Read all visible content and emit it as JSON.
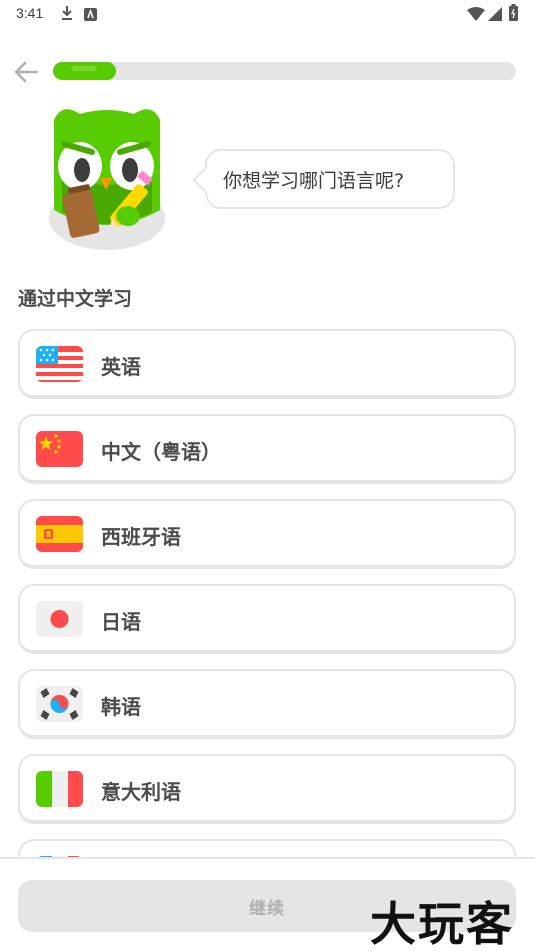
{
  "status_bar": {
    "time": "3:41"
  },
  "header": {
    "progress": 0.135
  },
  "mascot": {
    "speech": "你想学习哪门语言呢?"
  },
  "section": {
    "title": "通过中文学习"
  },
  "languages": [
    {
      "label": "英语",
      "flag": "us-flag-icon"
    },
    {
      "label": "中文（粤语）",
      "flag": "china-flag-icon"
    },
    {
      "label": "西班牙语",
      "flag": "spain-flag-icon"
    },
    {
      "label": "日语",
      "flag": "japan-flag-icon"
    },
    {
      "label": "韩语",
      "flag": "korea-flag-icon"
    },
    {
      "label": "意大利语",
      "flag": "italy-flag-icon"
    }
  ],
  "footer": {
    "continue_label": "继续"
  },
  "watermark": {
    "text": "大玩客"
  },
  "colors": {
    "accent": "#58cc02",
    "border": "#e5e5e5",
    "text": "#4b4b4b",
    "disabled_text": "#afafaf"
  }
}
